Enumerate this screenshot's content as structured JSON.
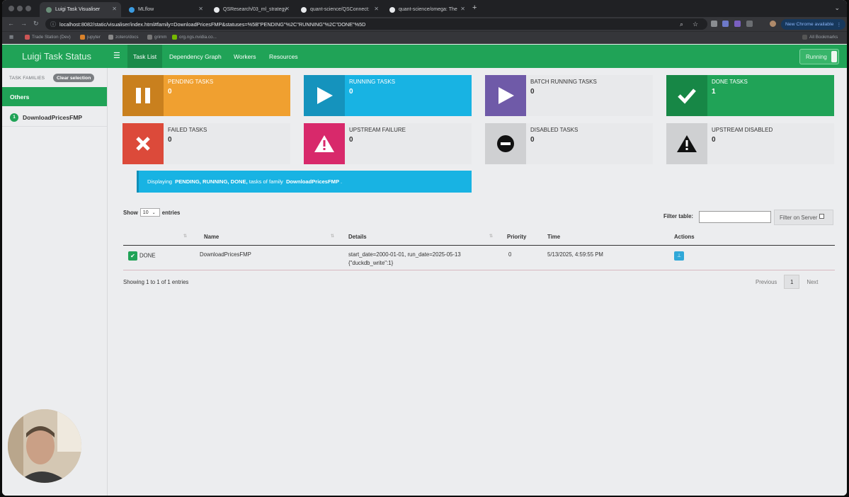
{
  "browser": {
    "tabs": [
      {
        "label": "Luigi Task Visualiser",
        "active": true
      },
      {
        "label": "MLflow",
        "active": false
      },
      {
        "label": "QSResearch/03_ml_strategy",
        "active": false
      },
      {
        "label": "quant-science/QSConnect: ",
        "active": false
      },
      {
        "label": "quant-science/omega: The",
        "active": false
      }
    ],
    "url": "localhost:8082/static/visualiser/index.html#family=DownloadPricesFMP&statuses=%5B\"PENDING\"%2C\"RUNNING\"%2C\"DONE\"%5D",
    "update_button": "New Chrome available",
    "bookmarks": [
      "Trade Station (Dev)",
      "jupyter",
      "zotero/docs",
      "grimm",
      "org.ngs.nvidia.co...",
      "All Bookmarks"
    ]
  },
  "navbar": {
    "brand": "Luigi Task Status",
    "links": [
      "Task List",
      "Dependency Graph",
      "Workers",
      "Resources"
    ],
    "running_label": "Running"
  },
  "sidebar": {
    "families_label": "TASK FAMILIES",
    "clear_label": "Clear selection",
    "others_label": "Others",
    "item": {
      "count": "1",
      "name": "DownloadPricesFMP"
    }
  },
  "status_boxes": [
    {
      "label": "PENDING TASKS",
      "value": "0",
      "icon": "pause-icon",
      "color": "#f0a030"
    },
    {
      "label": "RUNNING TASKS",
      "value": "0",
      "icon": "play-icon",
      "color": "#18b3e3"
    },
    {
      "label": "BATCH RUNNING TASKS",
      "value": "0",
      "icon": "play-icon",
      "color": "#6f5aa8"
    },
    {
      "label": "DONE TASKS",
      "value": "1",
      "icon": "check-icon",
      "color": "#20a357"
    },
    {
      "label": "FAILED TASKS",
      "value": "0",
      "icon": "x-icon",
      "color": "#dc4a3a"
    },
    {
      "label": "UPSTREAM FAILURE",
      "value": "0",
      "icon": "warning-icon",
      "color": "#d8296b"
    },
    {
      "label": "DISABLED TASKS",
      "value": "0",
      "icon": "minus-circle-icon",
      "color": "#cfd0d2"
    },
    {
      "label": "UPSTREAM DISABLED",
      "value": "0",
      "icon": "warning-icon",
      "color": "#cfd0d2"
    }
  ],
  "alert": {
    "prefix": "Displaying",
    "statuses": "PENDING, RUNNING, DONE,",
    "middle": "tasks of family",
    "family": "DownloadPricesFMP",
    "suffix": "."
  },
  "table": {
    "show_label": "Show",
    "show_value": "10",
    "entries_label": "entries",
    "filter_label": "Filter table:",
    "filter_server_label": "Filter on Server",
    "headers": [
      "",
      "Name",
      "Details",
      "Priority",
      "Time",
      "Actions"
    ],
    "rows": [
      {
        "status": "DONE",
        "name": "DownloadPricesFMP",
        "details_line1": "start_date=2000-01-01, run_date=2025-05-13",
        "details_line2": "{\"duckdb_write\":1}",
        "priority": "0",
        "time": "5/13/2025, 4:59:55 PM"
      }
    ],
    "info": "Showing 1 to 1 of 1 entries",
    "prev": "Previous",
    "page": "1",
    "next": "Next"
  }
}
